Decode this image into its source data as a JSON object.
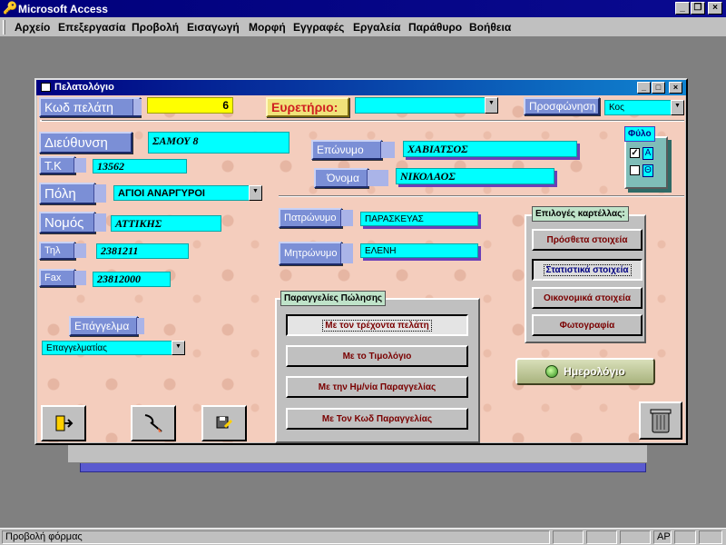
{
  "app": {
    "title": "Microsoft Access",
    "menu": [
      "Αρχείο",
      "Επεξεργασία",
      "Προβολή",
      "Εισαγωγή",
      "Μορφή",
      "Εγγραφές",
      "Εργαλεία",
      "Παράθυρο",
      "Βοήθεια"
    ]
  },
  "window": {
    "title": "Πελατολόγιο"
  },
  "form": {
    "customer_code_label": "Κωδ πελάτη",
    "customer_code_value": "6",
    "index_label": "Ευρετήριο:",
    "index_value": "",
    "salutation_label": "Προσφώνηση",
    "salutation_value": "Κος",
    "address_label": "Διεύθυνση",
    "address_value": "ΣΑΜΟΥ 8",
    "zip_label": "Τ.Κ",
    "zip_value": "13562",
    "city_label": "Πόλη",
    "city_value": "ΑΓΙΟΙ ΑΝΑΡΓΥΡΟΙ",
    "prefecture_label": "Νομός",
    "prefecture_value": "ΑΤΤΙΚΗΣ",
    "phone_label": "Τηλ",
    "phone_value": "2381211",
    "fax_label": "Fax",
    "fax_value": "23812000",
    "surname_label": "Επώνυμο",
    "surname_value": "ΧΑΒΙΑΤΣΟΣ",
    "firstname_label": "Όνομα",
    "firstname_value": "ΝΙΚΟΛΑΟΣ",
    "fathers_name_label": "Πατρώνυμο",
    "fathers_name_value": "ΠΑΡΑΣΚΕΥΑΣ",
    "mothers_name_label": "Μητρώνυμο",
    "mothers_name_value": "ΕΛΕΝΗ",
    "profession_label": "Επάγγελμα",
    "profession_value": "Επαγγελματίας",
    "gender": {
      "title": "Φύλο",
      "options": [
        {
          "label": "Α",
          "checked": true
        },
        {
          "label": "Θ",
          "checked": false
        }
      ]
    },
    "sales_orders": {
      "title": "Παραγγελίες Πώλησης",
      "buttons": [
        "Με τον τρέχοντα πελάτη",
        "Με το Τιμολόγιο",
        "Με την Ημ/νία Παραγγελίας",
        "Με Τον Κωδ Παραγγελίας"
      ]
    },
    "tab_options": {
      "title": "Επιλογές καρτέλλας:",
      "buttons": [
        "Πρόσθετα στοιχεία",
        "Στατιστικά στοιχεία",
        "Οικονομικά στοιχεία",
        "Φωτογραφία"
      ]
    },
    "calendar_label": "Ημερολόγιο"
  },
  "status": {
    "text": "Προβολή φόρμας",
    "ap": "AP"
  },
  "colors": {
    "field": "#00ffff",
    "label_button": "#7b8fd6",
    "form_background": "#f4cdbd",
    "title_bar": "#000080"
  }
}
